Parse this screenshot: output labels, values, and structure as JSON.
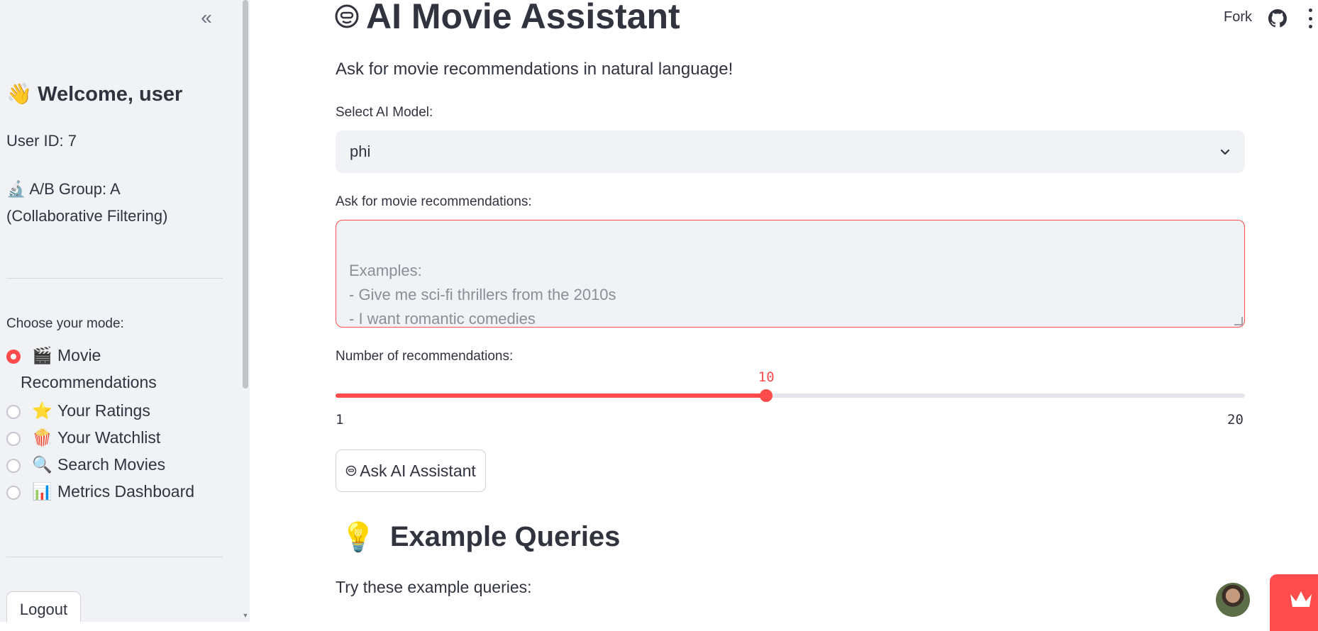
{
  "sidebar": {
    "collapse_label": "«",
    "welcome_emoji": "👋",
    "welcome": "Welcome, user",
    "user_id": "User ID: 7",
    "ab_group_emoji": "🔬",
    "ab_group_line1": "A/B Group: A",
    "ab_group_line2": "(Collaborative Filtering)",
    "mode_label": "Choose your mode:",
    "modes": [
      {
        "emoji": "🎬",
        "label": "Movie",
        "label2": "Recommendations",
        "selected": true
      },
      {
        "emoji": "⭐",
        "label": "Your Ratings",
        "selected": false
      },
      {
        "emoji": "🍿",
        "label": "Your Watchlist",
        "selected": false
      },
      {
        "emoji": "🔍",
        "label": "Search Movies",
        "selected": false
      },
      {
        "emoji": "📊",
        "label": "Metrics Dashboard",
        "selected": false
      }
    ],
    "logout_label": "Logout"
  },
  "toolbar": {
    "fork_label": "Fork",
    "github_icon": "github-icon",
    "menu_icon": "kebab-menu-icon"
  },
  "main": {
    "title": "AI Movie Assistant",
    "subtitle": "Ask for movie recommendations in natural language!",
    "model_label": "Select AI Model:",
    "model_value": "phi",
    "query_label": "Ask for movie recommendations:",
    "query_placeholder": "Examples:\n- Give me sci-fi thrillers from the 2010s\n- I want romantic comedies\n- Recommend action movies like Die Hard",
    "count_label": "Number of recommendations:",
    "slider": {
      "min": 1,
      "max": 20,
      "value": 10,
      "min_label": "1",
      "max_label": "20",
      "value_label": "10"
    },
    "ask_button_label": "Ask AI Assistant",
    "examples_emoji": "💡",
    "examples_title": "Example Queries",
    "try_text": "Try these example queries:"
  },
  "colors": {
    "accent": "#ff4b4b",
    "sidebar_bg": "#f0f2f6",
    "text": "#31333f"
  }
}
